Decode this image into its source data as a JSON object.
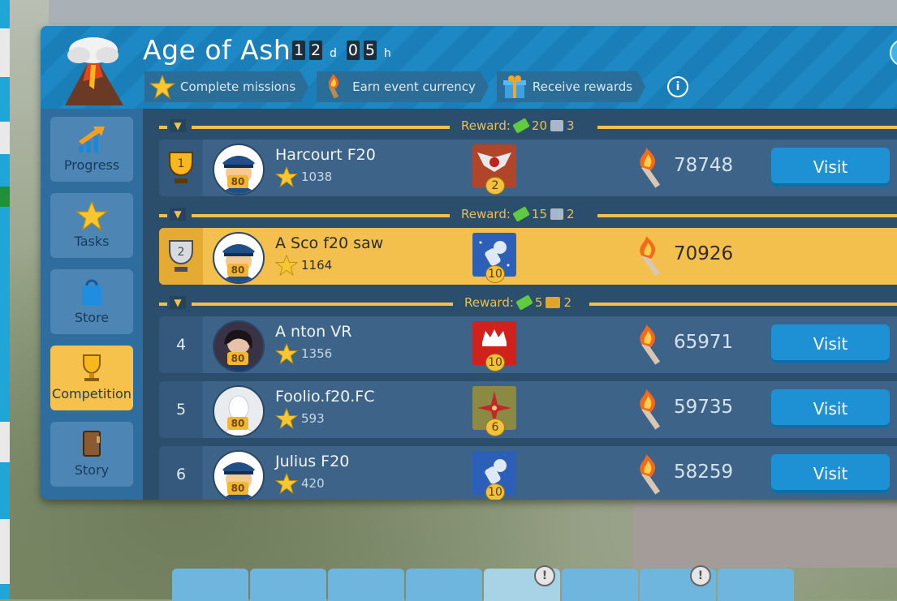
{
  "event": {
    "title": "Age of Ash",
    "timer": {
      "days": [
        "1",
        "2"
      ],
      "days_unit": "d",
      "hours": [
        "0",
        "5"
      ],
      "hours_unit": "h"
    }
  },
  "steps": [
    {
      "label": "Complete missions",
      "icon": "star-icon"
    },
    {
      "label": "Earn event currency",
      "icon": "torch-icon"
    },
    {
      "label": "Receive rewards",
      "icon": "gift-icon"
    }
  ],
  "info_icon": "i",
  "sidebar": {
    "items": [
      {
        "label": "Progress",
        "icon": "progress-arrow-icon"
      },
      {
        "label": "Tasks",
        "icon": "star-icon"
      },
      {
        "label": "Store",
        "icon": "shopping-bag-icon"
      },
      {
        "label": "Competition",
        "icon": "trophy-icon",
        "active": true
      },
      {
        "label": "Story",
        "icon": "book-icon"
      }
    ]
  },
  "rewards": [
    {
      "label": "Reward:",
      "cash": "20",
      "item": "3"
    },
    {
      "label": "Reward:",
      "cash": "15",
      "item": "2"
    },
    {
      "label": "Reward:",
      "cash": "5",
      "item": "2"
    }
  ],
  "players": [
    {
      "rank": "1",
      "name": "Harcourt F20",
      "stars": "1038",
      "level": "80",
      "badge_level": "2",
      "points": "78748",
      "visit": "Visit"
    },
    {
      "rank": "2",
      "name": "A Sco f20 saw",
      "stars": "1164",
      "level": "80",
      "badge_level": "10",
      "points": "70926",
      "visit": ""
    },
    {
      "rank": "4",
      "name": "A nton  VR",
      "stars": "1356",
      "level": "80",
      "badge_level": "10",
      "points": "65971",
      "visit": "Visit"
    },
    {
      "rank": "5",
      "name": "Foolio.f20.FC",
      "stars": "593",
      "level": "80",
      "badge_level": "6",
      "points": "59735",
      "visit": "Visit"
    },
    {
      "rank": "6",
      "name": "Julius F20",
      "stars": "420",
      "level": "80",
      "badge_level": "10",
      "points": "58259",
      "visit": "Visit"
    }
  ],
  "colors": {
    "accent": "#1d91d4",
    "highlight": "#f3bf4d",
    "gold": "#f0c24d"
  }
}
